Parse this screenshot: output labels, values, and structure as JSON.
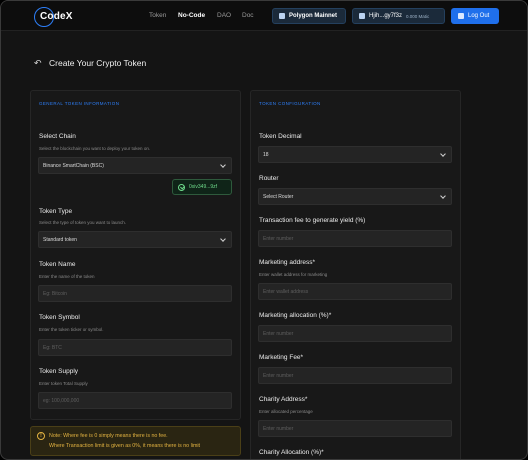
{
  "header": {
    "logo": "CodeX",
    "nav": [
      "Token",
      "No-Code",
      "DAO",
      "Doc"
    ],
    "network_button": "Polygon Mainnet",
    "wallet_address": "Hjih...gy7f3z",
    "wallet_balance": "0.000 Matic",
    "logout_button": "Log Out"
  },
  "page": {
    "title": "Create Your Crypto Token"
  },
  "left_panel": {
    "section_title": "GENERAL TOKEN INFORMATION",
    "chain": {
      "label": "Select Chain",
      "hint": "Select the blockchain you want to deploy your token on.",
      "value": "Binance SmartChain (BSC)",
      "badge": "0xiv349...9zf"
    },
    "token_type": {
      "label": "Token Type",
      "hint": "Select the type of token you want to launch.",
      "value": "Standard token"
    },
    "token_name": {
      "label": "Token Name",
      "hint": "Enter the name of the token",
      "placeholder": "Eg: Bitcoin"
    },
    "token_symbol": {
      "label": "Token Symbol",
      "hint": "Enter the token ticker or symbol.",
      "placeholder": "Eg: BTC"
    },
    "token_supply": {
      "label": "Token Supply",
      "hint": "Enter token Total Supply",
      "placeholder": "eg: 100,000,000"
    }
  },
  "note": {
    "line1": "Note: Where fee is 0 simply means there is no fee.",
    "line2": "Where Transaction limit is given as 0%, it means there is no limit"
  },
  "right_panel": {
    "section_title": "TOKEN CONFIGURATION",
    "decimal": {
      "label": "Token Decimal",
      "value": "18"
    },
    "router": {
      "label": "Router",
      "value": "Select Router"
    },
    "yield_fee": {
      "label": "Transaction fee to generate yield (%)",
      "placeholder": "Enter number"
    },
    "marketing_address": {
      "label": "Marketing address*",
      "hint": "Enter wallet address for marketing",
      "placeholder": "Enter wallet address"
    },
    "marketing_allocation": {
      "label": "Marketing allocation (%)*",
      "placeholder": "Enter number"
    },
    "marketing_fee": {
      "label": "Marketing Fee*",
      "placeholder": "Enter number"
    },
    "charity_address": {
      "label": "Charity Address*",
      "hint": "Enter allocated percentage",
      "placeholder": "Enter number"
    },
    "charity_allocation": {
      "label": "Charity Allocation (%)*"
    }
  }
}
